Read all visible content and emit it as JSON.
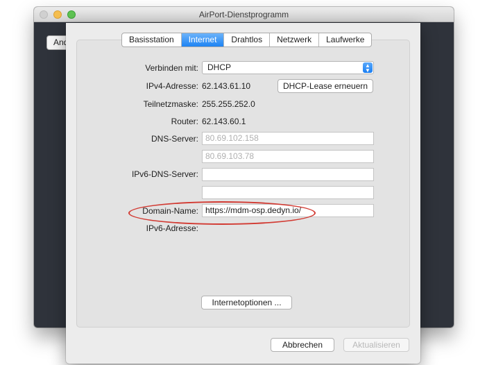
{
  "window": {
    "title": "AirPort-Dienstprogramm",
    "background_button_label": "And"
  },
  "tabs": [
    {
      "label": "Basisstation",
      "active": false
    },
    {
      "label": "Internet",
      "active": true
    },
    {
      "label": "Drahtlos",
      "active": false
    },
    {
      "label": "Netzwerk",
      "active": false
    },
    {
      "label": "Laufwerke",
      "active": false
    }
  ],
  "form": {
    "connect_label": "Verbinden mit:",
    "connect_value": "DHCP",
    "ipv4_label": "IPv4-Adresse:",
    "ipv4_value": "62.143.61.10",
    "renew_button": "DHCP-Lease erneuern",
    "subnet_label": "Teilnetzmaske:",
    "subnet_value": "255.255.252.0",
    "router_label": "Router:",
    "router_value": "62.143.60.1",
    "dns_label": "DNS-Server:",
    "dns1_placeholder": "80.69.102.158",
    "dns2_placeholder": "80.69.103.78",
    "ipv6_dns_label": "IPv6-DNS-Server:",
    "ipv6_dns1_value": "",
    "ipv6_dns2_value": "",
    "domain_label": "Domain-Name:",
    "domain_value": "https://mdm-osp.dedyn.io/",
    "ipv6_address_label": "IPv6-Adresse:",
    "internet_options_button": "Internetoptionen ..."
  },
  "footer": {
    "cancel_button": "Abbrechen",
    "update_button": "Aktualisieren"
  },
  "colors": {
    "accent": "#1d83f3",
    "annotation": "#d23a32",
    "window_dark": "#2f333b"
  }
}
